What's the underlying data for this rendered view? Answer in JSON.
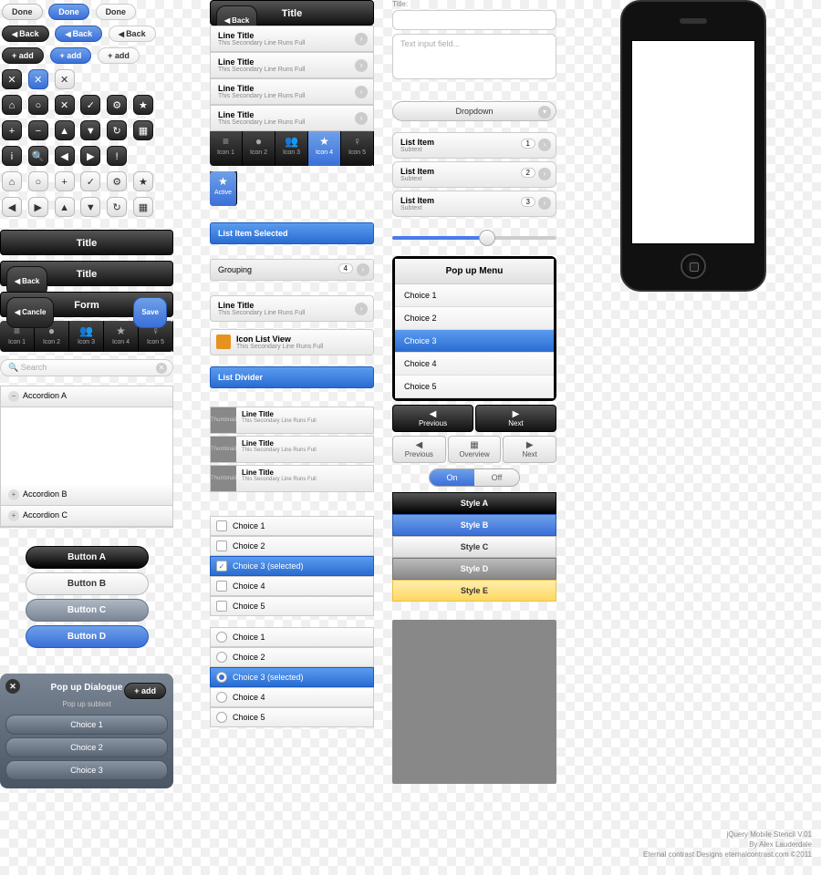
{
  "pills": {
    "done": "Done",
    "back": "Back",
    "add": "+ add",
    "cancel": "Cancle",
    "save": "Save"
  },
  "headers": {
    "title": "Title",
    "form": "Form"
  },
  "tabbar": {
    "items": [
      "Icon 1",
      "Icon 2",
      "Icon 3",
      "Icon 4",
      "Icon 5"
    ],
    "active_label": "Active"
  },
  "search": {
    "placeholder": "Search"
  },
  "accordion": {
    "a": "Accordion A",
    "b": "Accordion B",
    "c": "Accordion C"
  },
  "buttons": {
    "a": "Button A",
    "b": "Button B",
    "c": "Button C",
    "d": "Button D"
  },
  "popup_dialog": {
    "title": "Pop up Dialogue",
    "subtext": "Pop up subtext",
    "choices": [
      "Choice 1",
      "Choice 2",
      "Choice 3"
    ]
  },
  "list": {
    "title": "Line Title",
    "sub": "This Secondary Line Runs Full",
    "selected": "List Item Selected",
    "grouping": "Grouping",
    "group_count": "4",
    "iconlist": "Icon List View",
    "divider": "List Divider"
  },
  "thumb_label": "Thumbnail",
  "checks": {
    "c1": "Choice 1",
    "c2": "Choice 2",
    "c3": "Choice 3 (selected)",
    "c4": "Choice 4",
    "c5": "Choice 5"
  },
  "radios": {
    "r1": "Choice 1",
    "r2": "Choice 2",
    "r3": "Choice 3 (selected)",
    "r4": "Choice 4",
    "r5": "Choice 5"
  },
  "inputs": {
    "title_label": "Title:",
    "text_placeholder": "Text input field..."
  },
  "dropdown": "Dropdown",
  "list_items": [
    {
      "title": "List Item",
      "sub": "Subtext",
      "num": "1"
    },
    {
      "title": "List Item",
      "sub": "Subtext",
      "num": "2"
    },
    {
      "title": "List Item",
      "sub": "Subtext",
      "num": "3"
    }
  ],
  "popmenu": {
    "title": "Pop up Menu",
    "choices": [
      "Choice 1",
      "Choice 2",
      "Choice 3",
      "Choice 4",
      "Choice 5"
    ]
  },
  "nav": {
    "prev": "Previous",
    "over": "Overview",
    "next": "Next"
  },
  "toggle": {
    "on": "On",
    "off": "Off"
  },
  "styles": {
    "a": "Style A",
    "b": "Style B",
    "c": "Style C",
    "d": "Style D",
    "e": "Style E"
  },
  "credits": {
    "l1": "jQuery Mobile Stencil V.01",
    "l2": "By Alex Lauderdale",
    "l3": "Eternal contrast Designs  eternalcontrast.com  ©2011"
  }
}
